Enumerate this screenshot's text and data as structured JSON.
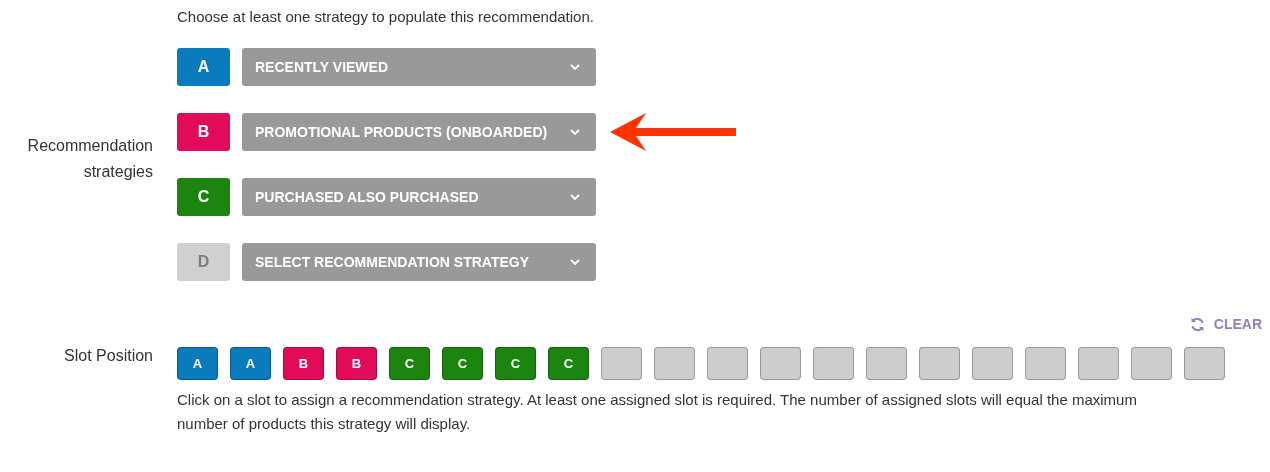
{
  "intro": "Choose at least one strategy to populate this recommendation.",
  "strategies_label": "Recommendation strategies",
  "strategies": [
    {
      "letter": "A",
      "color": "#0a7bbd",
      "disabled": false,
      "value": "RECENTLY VIEWED",
      "pointed": false
    },
    {
      "letter": "B",
      "color": "#e10b5a",
      "disabled": false,
      "value": "PROMOTIONAL PRODUCTS (ONBOARDED)",
      "pointed": true
    },
    {
      "letter": "C",
      "color": "#1b8510",
      "disabled": false,
      "value": "PURCHASED ALSO PURCHASED",
      "pointed": false
    },
    {
      "letter": "D",
      "color": "#d0d0d0",
      "disabled": true,
      "value": "SELECT RECOMMENDATION STRATEGY",
      "pointed": false
    }
  ],
  "clear_button": "CLEAR",
  "slots_label": "Slot Position",
  "slots": [
    {
      "assigned": true,
      "label": "A",
      "color": "#0a7bbd"
    },
    {
      "assigned": true,
      "label": "A",
      "color": "#0a7bbd"
    },
    {
      "assigned": true,
      "label": "B",
      "color": "#e10b5a"
    },
    {
      "assigned": true,
      "label": "B",
      "color": "#e10b5a"
    },
    {
      "assigned": true,
      "label": "C",
      "color": "#1b8510"
    },
    {
      "assigned": true,
      "label": "C",
      "color": "#1b8510"
    },
    {
      "assigned": true,
      "label": "C",
      "color": "#1b8510"
    },
    {
      "assigned": true,
      "label": "C",
      "color": "#1b8510"
    },
    {
      "assigned": false
    },
    {
      "assigned": false
    },
    {
      "assigned": false
    },
    {
      "assigned": false
    },
    {
      "assigned": false
    },
    {
      "assigned": false
    },
    {
      "assigned": false
    },
    {
      "assigned": false
    },
    {
      "assigned": false
    },
    {
      "assigned": false
    },
    {
      "assigned": false
    },
    {
      "assigned": false
    }
  ],
  "help": "Click on a slot to assign a recommendation strategy. At least one assigned slot is required. The number of assigned slots will equal the maximum number of products this strategy will display."
}
